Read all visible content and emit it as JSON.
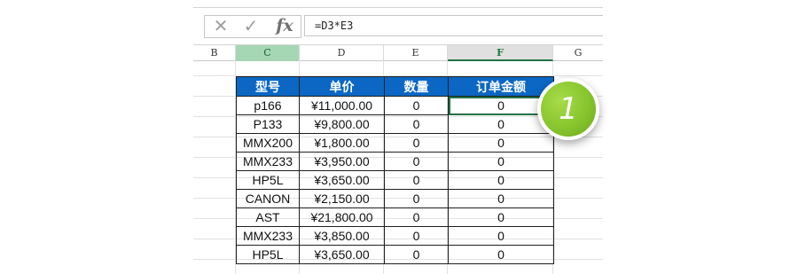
{
  "formula_bar": {
    "cancel_icon": "✕",
    "enter_icon": "✓",
    "function_icon": "fx",
    "formula": "=D3*E3"
  },
  "columns": [
    "B",
    "C",
    "D",
    "E",
    "F",
    "G"
  ],
  "table": {
    "headers": [
      "型号",
      "单价",
      "数量",
      "订单金额"
    ],
    "rows": [
      [
        "p166",
        "¥11,000.00",
        "0",
        "0"
      ],
      [
        "P133",
        "¥9,800.00",
        "0",
        "0"
      ],
      [
        "MMX200",
        "¥1,800.00",
        "0",
        "0"
      ],
      [
        "MMX233",
        "¥3,950.00",
        "0",
        "0"
      ],
      [
        "HP5L",
        "¥3,650.00",
        "0",
        "0"
      ],
      [
        "CANON",
        "¥2,150.00",
        "0",
        "0"
      ],
      [
        "AST",
        "¥21,800.00",
        "0",
        "0"
      ],
      [
        "MMX233",
        "¥3,850.00",
        "0",
        "0"
      ],
      [
        "HP5L",
        "¥3,650.00",
        "0",
        "0"
      ]
    ]
  },
  "callout": {
    "number": "1",
    "color": "#86c52d"
  },
  "colors": {
    "header_bg": "#0b67c3",
    "selection": "#217346"
  }
}
